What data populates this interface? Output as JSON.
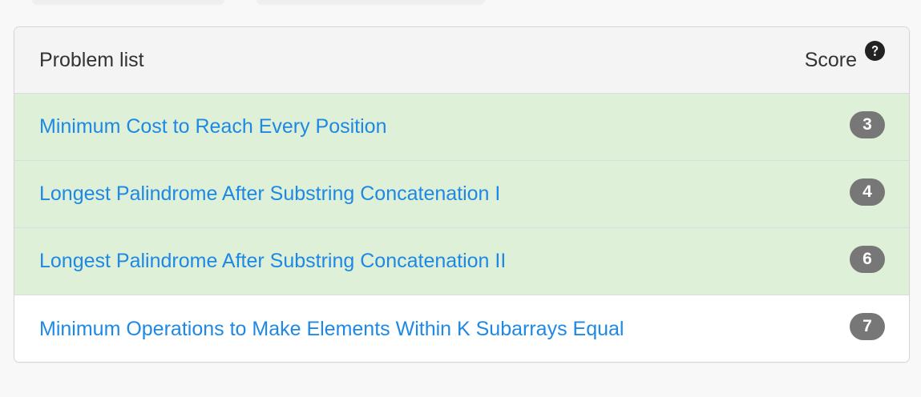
{
  "panel": {
    "header": {
      "title": "Problem list",
      "score_label": "Score",
      "help_icon": "question-circle-icon"
    },
    "problems": [
      {
        "title": "Minimum Cost to Reach Every Position",
        "score": "3",
        "status": "solved"
      },
      {
        "title": "Longest Palindrome After Substring Concatenation I",
        "score": "4",
        "status": "solved"
      },
      {
        "title": "Longest Palindrome After Substring Concatenation II",
        "score": "6",
        "status": "solved"
      },
      {
        "title": "Minimum Operations to Make Elements Within K Subarrays Equal",
        "score": "7",
        "status": "unsolved"
      }
    ]
  },
  "colors": {
    "solved_row": "#dff0d8",
    "link": "#1e88e5",
    "badge": "#777777"
  }
}
